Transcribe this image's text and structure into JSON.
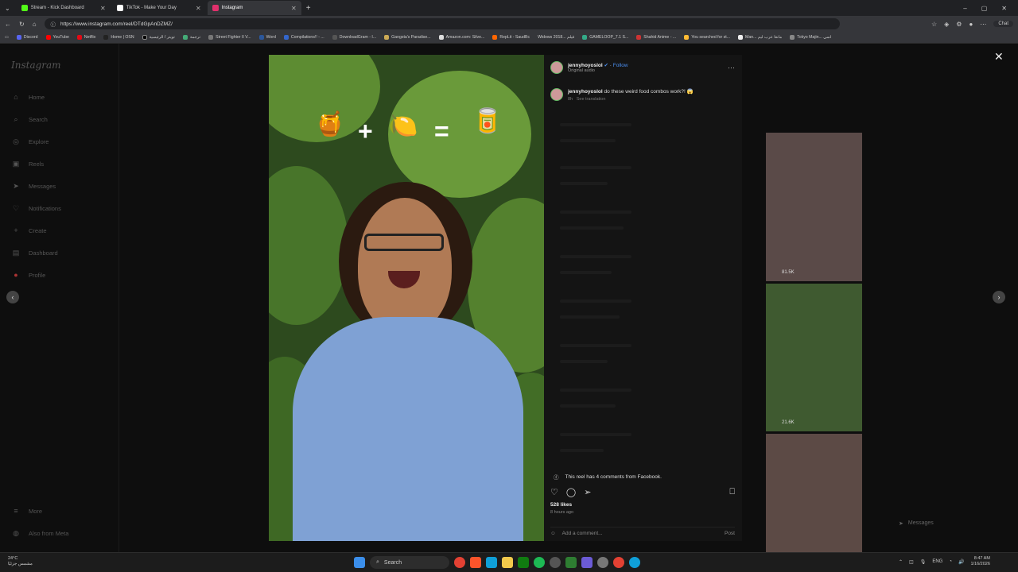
{
  "tabs": [
    {
      "label": "Stream - Kick Dashboard",
      "color": "#53fc18"
    },
    {
      "label": "TikTok - Make Your Day",
      "color": "#ffffff"
    },
    {
      "label": "Instagram",
      "color": "#e1306c"
    }
  ],
  "url": "https://www.instagram.com/reel/DTdGpAnDZMZ/",
  "chat_label": "Chat",
  "bookmarks": [
    "Discord",
    "YouTube",
    "Netflix",
    "Home | OSN",
    "تويتر / الرئيسية",
    "ترجمة",
    "Street Fighter II V...",
    "Word",
    "Compilations!! - ...",
    "DownloadGram - I...",
    "Gangsta's Paradise...",
    "Amazon.com: Silve...",
    "RepLit - SaudBc",
    "Widows 2018... فيلم",
    "GAMELOOP_7.1 S...",
    "Shahid Anime - ...",
    "You searched for st...",
    "Man... مانغا عرب ليم",
    "Tokyo Majin... انمي"
  ],
  "sidebar": {
    "logo": "Instagram",
    "items": [
      "Home",
      "Search",
      "Explore",
      "Reels",
      "Messages",
      "Notifications",
      "Create",
      "Dashboard",
      "Profile"
    ],
    "bottom": [
      "More",
      "Also from Meta"
    ]
  },
  "post": {
    "username": "jennyhoyoslol",
    "follow": "Follow",
    "audio": "Original audio",
    "caption": "do these weird food combos work?! 😱",
    "caption_time": "8h",
    "see_translation": "See translation",
    "fb_comments": "This reel has 4 comments from Facebook.",
    "likes": "528 likes",
    "posted": "8 hours ago",
    "comment_placeholder": "Add a comment...",
    "post_label": "Post"
  },
  "thumbnails": [
    {
      "caption": "81.5K"
    },
    {
      "caption": "21.6K"
    },
    {
      "caption": ""
    }
  ],
  "side_messages": "Messages",
  "taskbar": {
    "weather_temp": "24°C",
    "weather_desc": "مشمس جزئيًا",
    "search": "Search",
    "lang": "ENG",
    "time": "8:47 AM",
    "date": "1/16/2026"
  }
}
